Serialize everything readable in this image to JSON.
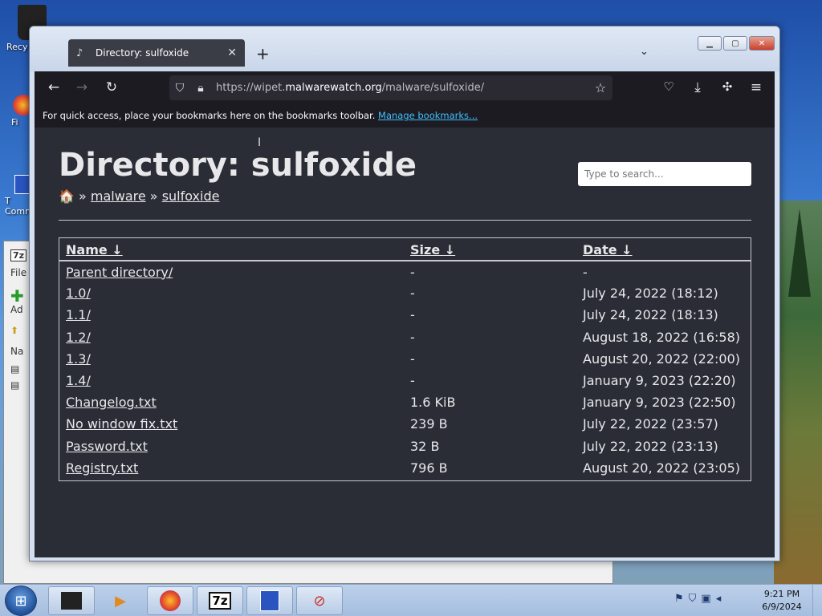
{
  "desktop": {
    "icons": [
      {
        "label": "Recy",
        "glyph": "trash-icon"
      },
      {
        "label": "Fi",
        "glyph": "firefox-icon"
      },
      {
        "label": "T Comm",
        "glyph": "floppy-icon"
      }
    ]
  },
  "bg_window": {
    "app_icon": "7z",
    "menu_file": "File",
    "add_label": "Ad",
    "column_name": "Na"
  },
  "browser": {
    "tab_title": "Directory: sulfoxide",
    "new_tab": "+",
    "url_prefix": "https://wipet.",
    "url_host": "malwarewatch.org",
    "url_path": "/malware/sulfoxide/",
    "bookmarks_text": "For quick access, place your bookmarks here on the bookmarks toolbar.",
    "bookmarks_link": "Manage bookmarks..."
  },
  "page": {
    "heading": "Directory: sulfoxide",
    "breadcrumb": {
      "home": "🏠",
      "sep": "»",
      "items": [
        "malware",
        "sulfoxide"
      ]
    },
    "search_placeholder": "Type to search...",
    "columns": [
      "Name ↓",
      "Size ↓",
      "Date ↓"
    ],
    "rows": [
      {
        "name": "Parent directory/",
        "size": "-",
        "date": "-"
      },
      {
        "name": "1.0/",
        "size": "-",
        "date": "July 24, 2022 (18:12)"
      },
      {
        "name": "1.1/",
        "size": "-",
        "date": "July 24, 2022 (18:13)"
      },
      {
        "name": "1.2/",
        "size": "-",
        "date": "August 18, 2022 (16:58)"
      },
      {
        "name": "1.3/",
        "size": "-",
        "date": "August 20, 2022 (22:00)"
      },
      {
        "name": "1.4/",
        "size": "-",
        "date": "January 9, 2023 (22:20)"
      },
      {
        "name": "Changelog.txt",
        "size": "1.6 KiB",
        "date": "January 9, 2023 (22:50)"
      },
      {
        "name": "No window fix.txt",
        "size": "239 B",
        "date": "July 22, 2022 (23:57)"
      },
      {
        "name": "Password.txt",
        "size": "32 B",
        "date": "July 22, 2022 (23:13)"
      },
      {
        "name": "Registry.txt",
        "size": "796 B",
        "date": "August 20, 2022 (23:05)"
      }
    ]
  },
  "taskbar": {
    "time": "9:21 PM",
    "date": "6/9/2024",
    "sevenzip_label": "7z"
  }
}
